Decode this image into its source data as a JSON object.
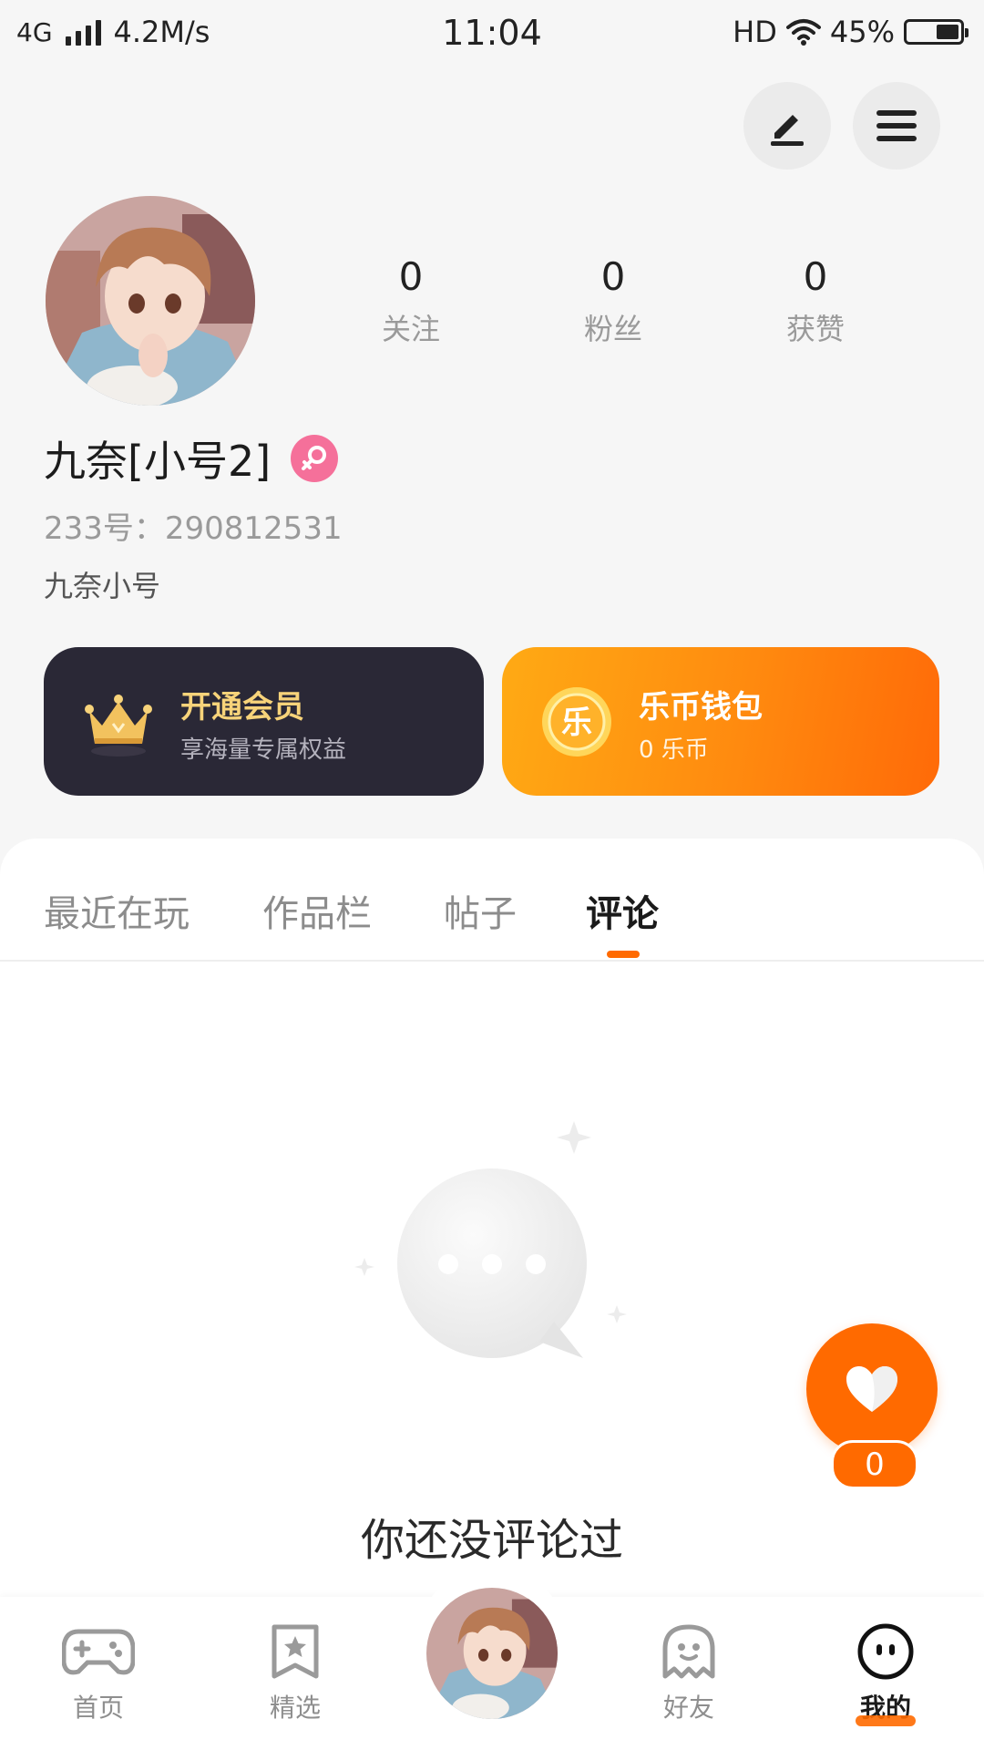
{
  "status_bar": {
    "network": "4G",
    "speed": "4.2M/s",
    "time": "11:04",
    "hd": "HD",
    "battery": "45%",
    "battery_level": 0.45
  },
  "profile": {
    "nickname": "九奈[小号2]",
    "id_line": "233号：290812531",
    "bio": "九奈小号",
    "stats": [
      {
        "num": "0",
        "label": "关注"
      },
      {
        "num": "0",
        "label": "粉丝"
      },
      {
        "num": "0",
        "label": "获赞"
      }
    ]
  },
  "cards": {
    "vip": {
      "title": "开通会员",
      "subtitle": "享海量专属权益"
    },
    "wallet": {
      "title": "乐币钱包",
      "subtitle": "0 乐币",
      "icon_char": "乐"
    }
  },
  "tabs": [
    {
      "label": "最近在玩",
      "active": false
    },
    {
      "label": "作品栏",
      "active": false
    },
    {
      "label": "帖子",
      "active": false
    },
    {
      "label": "评论",
      "active": true
    }
  ],
  "empty": {
    "text": "你还没评论过"
  },
  "fab": {
    "count": "0"
  },
  "nav": [
    {
      "label": "首页",
      "icon": "gamepad-icon"
    },
    {
      "label": "精选",
      "icon": "star-bookmark-icon"
    },
    {
      "label": "",
      "icon": "avatar"
    },
    {
      "label": "好友",
      "icon": "ghost-icon"
    },
    {
      "label": "我的",
      "icon": "face-icon",
      "active": true
    }
  ],
  "colors": {
    "accent": "#ff6a00",
    "vip_bg": "#2a2836",
    "vip_title": "#f7d37a",
    "gender_badge": "#f5709a"
  }
}
